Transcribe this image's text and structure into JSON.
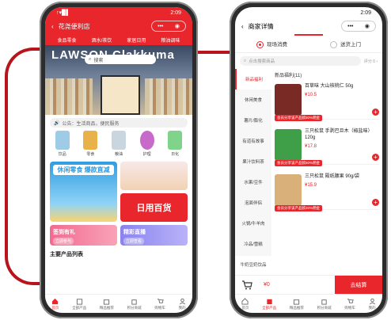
{
  "left": {
    "status": {
      "time": "2:09",
      "signal": "↑▾▉▌"
    },
    "nav": {
      "title": "花尧便利店",
      "dots": "•••"
    },
    "categories": [
      "食品零食",
      "酒水/茶饮",
      "家居日用",
      "粮油调味"
    ],
    "banner": {
      "sign": "LAWSON  Clakkuma",
      "search_placeholder": "搜索"
    },
    "notice": "公告：生活商品，便民服务",
    "products": [
      {
        "label": "饮品",
        "color": "#9ecbe6"
      },
      {
        "label": "零食",
        "color": "#e8b14a"
      },
      {
        "label": "粮油",
        "color": "#c9d6e0"
      },
      {
        "label": "护理",
        "color": "#c86ac9"
      },
      {
        "label": "日化",
        "color": "#7fd38a"
      }
    ],
    "tiles": {
      "t1": "休闲零食  爆款直减",
      "t3": "日用百货",
      "t4": {
        "title": "签到有礼",
        "sub": "立即参与"
      },
      "t5": {
        "title": "精彩直播",
        "sub": "立即查看"
      }
    },
    "section_title": "主要产品列表",
    "tabs": [
      "首页",
      "全部产品",
      "精品推荐",
      "积分商城",
      "购物车",
      "我的"
    ]
  },
  "right": {
    "status": {
      "time": "2:09"
    },
    "nav": {
      "title": "商家详情",
      "dots": "•••"
    },
    "modes": [
      "现场消费",
      "送货上门"
    ],
    "search_placeholder": "点击搜索商品",
    "rating": "评分 0 ›",
    "sidebar": [
      "新品福利",
      "休闲美食",
      "薯片/膨化",
      "有道有故事",
      "果汁饮料茶",
      "水果/豆件",
      "泡面伴侣",
      "火锅/牛羊肉",
      "冷品/雪糕",
      "牛奶豆奶饮品"
    ],
    "list_title": "新品福利(11)",
    "items": [
      {
        "name": "百草味 大山核桃仁 50g",
        "price": "¥10.5",
        "coupon": "会员分享该产品赥50%佣金",
        "color": "#7a2a24"
      },
      {
        "name": "三只松鼠 手剥巴旦木（椒盐味）120g",
        "price": "¥17.8",
        "coupon": "会员分享该产品赥50%佣金",
        "color": "#3f9e48"
      },
      {
        "name": "三只松鼠 殿纸腰果 90g/袋",
        "price": "¥15.9",
        "coupon": "会员分享该产品赥20%佣金",
        "color": "#d9b079"
      }
    ],
    "cart": {
      "total": "¥0",
      "checkout": "去结算"
    },
    "tabs": [
      "首页",
      "全部产品",
      "精品推荐",
      "积分商城",
      "购物车",
      "我的"
    ]
  }
}
